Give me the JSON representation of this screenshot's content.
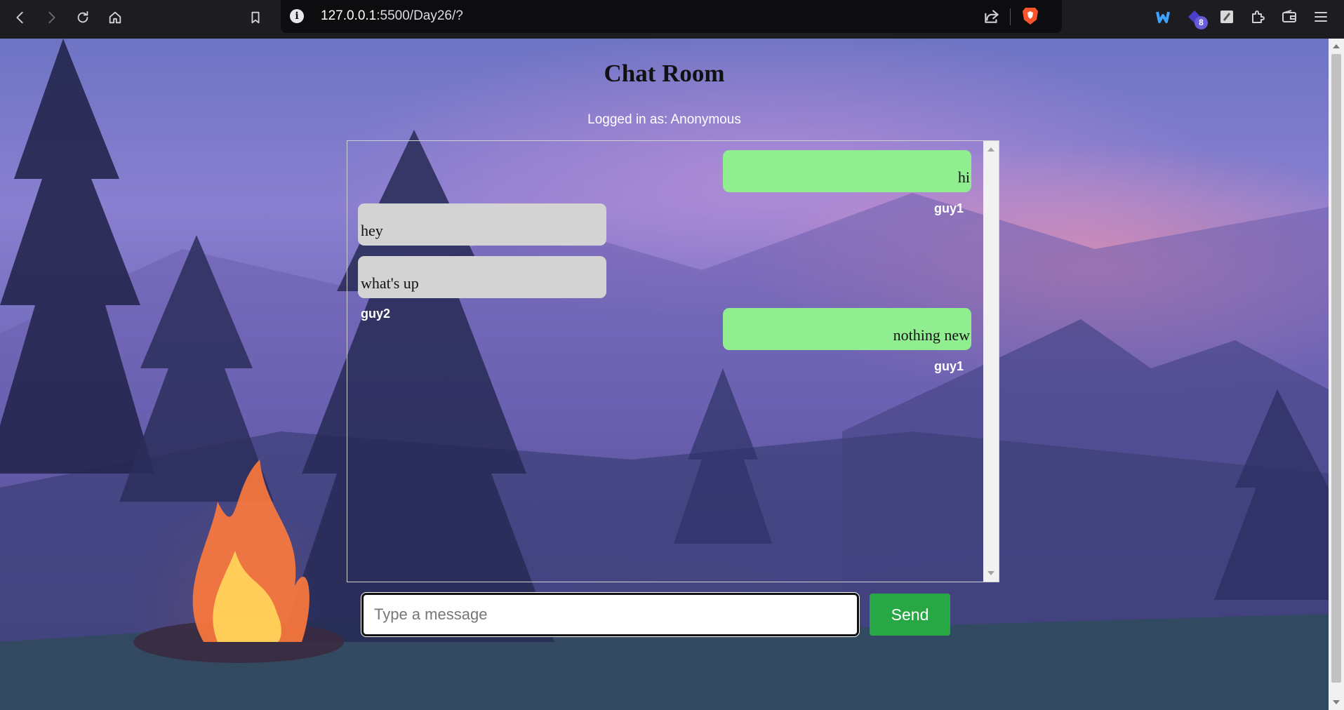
{
  "browser": {
    "url_host": "127.0.0.1",
    "url_rest": ":5500/Day26/?",
    "extension_badge": "8",
    "icons": [
      "back-icon",
      "forward-icon",
      "reload-icon",
      "home-icon",
      "bookmark-icon",
      "site-info-icon",
      "share-icon",
      "brave-shields-icon",
      "extension-blue-icon",
      "extension-purple-icon",
      "extension-notes-icon",
      "puzzle-extensions-icon",
      "wallet-icon",
      "menu-icon"
    ]
  },
  "page": {
    "title": "Chat Room",
    "logged_in": "Logged in as: Anonymous"
  },
  "messages": [
    {
      "text": "hi",
      "side": "right",
      "sender": "guy1"
    },
    {
      "text": "hey",
      "side": "left",
      "sender": ""
    },
    {
      "text": "what's up",
      "side": "left",
      "sender": "guy2"
    },
    {
      "text": "nothing new",
      "side": "right",
      "sender": "guy1"
    }
  ],
  "composer": {
    "placeholder": "Type a message",
    "send_label": "Send"
  },
  "colors": {
    "my_bubble": "#90ee90",
    "their_bubble": "#d3d3d3",
    "send_button": "#28a745"
  }
}
